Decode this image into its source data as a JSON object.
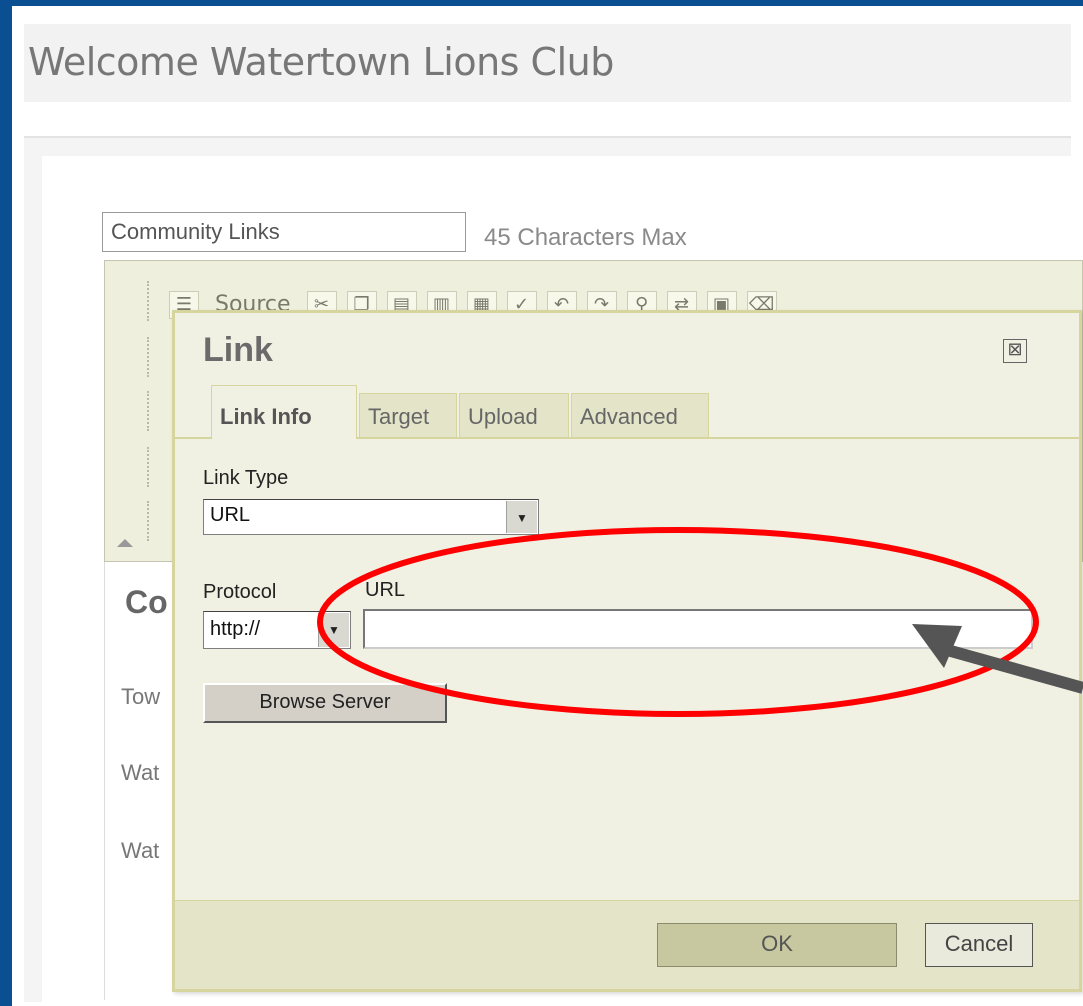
{
  "page": {
    "welcome_title": "Welcome Watertown Lions Club"
  },
  "form": {
    "title_value": "Community Links",
    "max_note": "45 Characters Max"
  },
  "editor": {
    "source_label": "Source",
    "heading_partial": "Co",
    "line1_partial": "Tow",
    "line2_partial": "Wat",
    "line3_partial": "Wat"
  },
  "dialog": {
    "title": "Link",
    "close_glyph": "⊠",
    "tabs": [
      {
        "label": "Link Info",
        "active": true
      },
      {
        "label": "Target",
        "active": false
      },
      {
        "label": "Upload",
        "active": false
      },
      {
        "label": "Advanced",
        "active": false
      }
    ],
    "link_type_label": "Link Type",
    "link_type_value": "URL",
    "protocol_label": "Protocol",
    "protocol_value": "http://",
    "url_label": "URL",
    "url_value": "",
    "browse_label": "Browse Server",
    "ok_label": "OK",
    "cancel_label": "Cancel"
  },
  "colors": {
    "frame_blue": "#0b4f93",
    "highlight_red": "#ff0000",
    "arrow_gray": "#555555"
  }
}
